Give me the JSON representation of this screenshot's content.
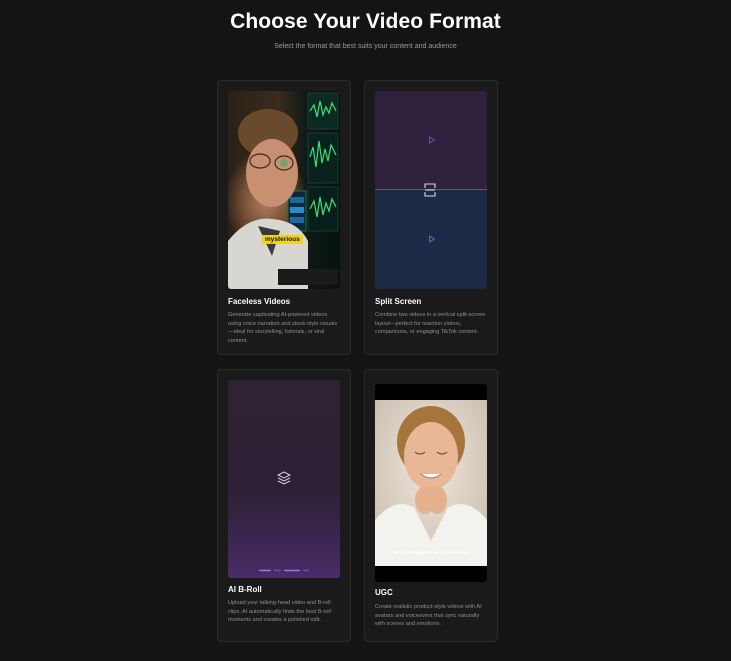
{
  "header": {
    "title": "Choose Your Video Format",
    "subtitle": "Select the format that best suits your content and audience"
  },
  "cards": [
    {
      "title": "Faceless Videos",
      "description": "Generate captivating AI-powered videos using voice narration and stock-style visuals—ideal for storytelling, tutorials, or viral content.",
      "preview_tag": "mysterious"
    },
    {
      "title": "Split Screen",
      "description": "Combine two videos in a vertical split-screen layout—perfect for reaction videos, comparisons, or engaging TikTok content."
    },
    {
      "title": "AI B-Roll",
      "description": "Upload your talking-head video and B-roll clips. AI automatically finds the best B-roll moments and creates a polished edit."
    },
    {
      "title": "UGC",
      "description": "Create realistic product-style videos with AI avatars and voiceovers that sync naturally with scenes and emotions.",
      "preview_caption": "Mein Anti-age Gb - el time le to tra"
    }
  ],
  "colors": {
    "background": "#141414",
    "card": "#1a1a1a",
    "tag": "#f2d21b",
    "accent_purple": "#8a5bd6"
  }
}
